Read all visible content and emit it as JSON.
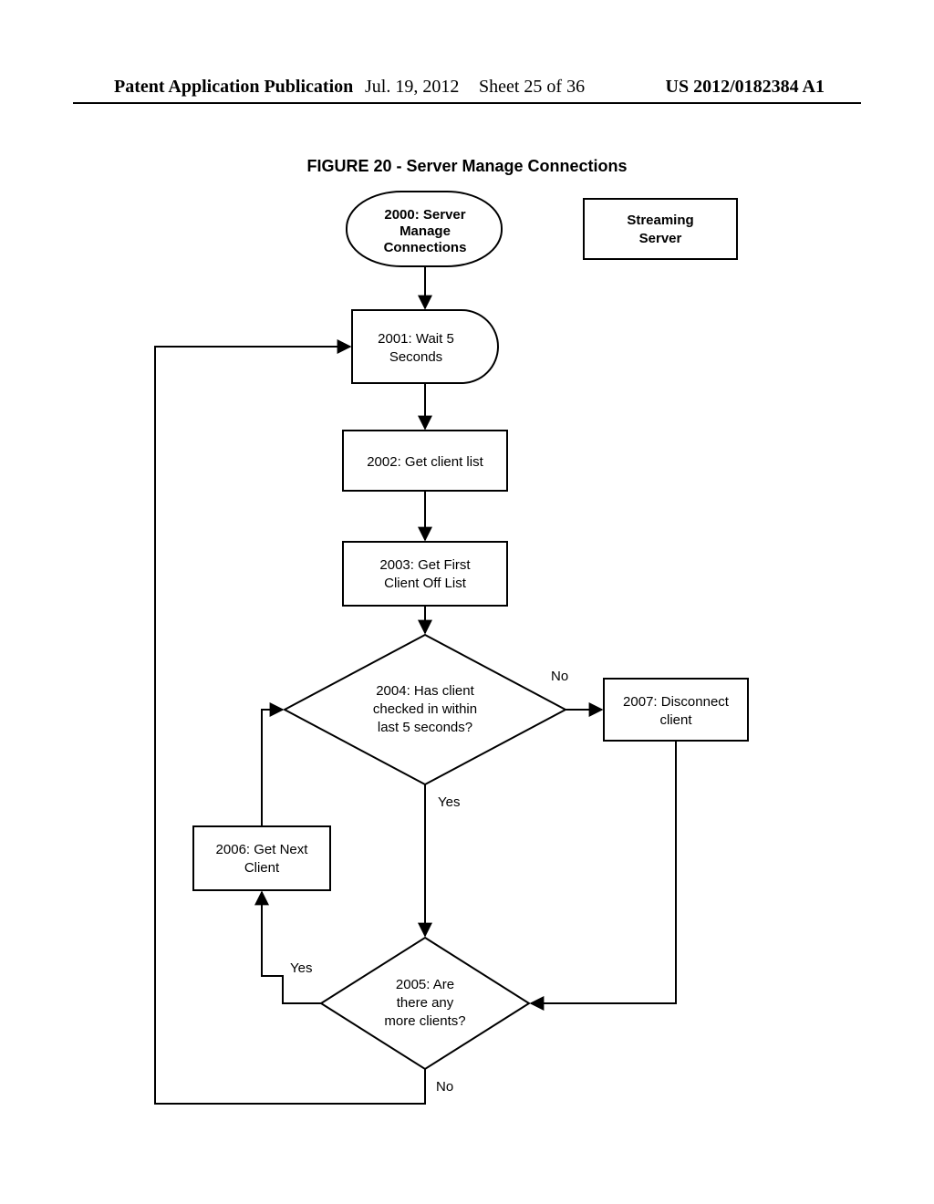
{
  "header": {
    "publication_label": "Patent Application Publication",
    "date": "Jul. 19, 2012",
    "sheet": "Sheet 25 of 36",
    "pub_no": "US 2012/0182384 A1"
  },
  "figure": {
    "title": "FIGURE 20 - Server Manage Connections"
  },
  "nodes": {
    "n2000_l1": "2000: Server",
    "n2000_l2": "Manage",
    "n2000_l3": "Connections",
    "streaming_l1": "Streaming",
    "streaming_l2": "Server",
    "n2001_l1": "2001: Wait 5",
    "n2001_l2": "Seconds",
    "n2002": "2002: Get client list",
    "n2003_l1": "2003: Get First",
    "n2003_l2": "Client Off List",
    "n2004_l1": "2004: Has client",
    "n2004_l2": "checked in within",
    "n2004_l3": "last 5 seconds?",
    "n2005_l1": "2005: Are",
    "n2005_l2": "there any",
    "n2005_l3": "more clients?",
    "n2006_l1": "2006: Get Next",
    "n2006_l2": "Client",
    "n2007_l1": "2007: Disconnect",
    "n2007_l2": "client"
  },
  "labels": {
    "no": "No",
    "yes": "Yes"
  }
}
